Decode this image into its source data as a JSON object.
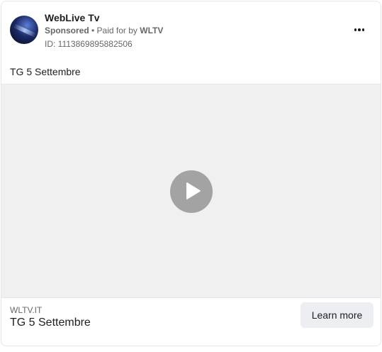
{
  "header": {
    "page_name": "WebLive Tv",
    "sponsored": "Sponsored",
    "separator": " • ",
    "paid_for_prefix": "Paid for by ",
    "paid_for_name": "WLTV",
    "ad_id": "ID: 1113869895882506",
    "more_icon": "more-horizontal-icon"
  },
  "post": {
    "text": "TG 5 Settembre"
  },
  "video": {
    "play_icon": "play-icon",
    "background_color": "#f0f0f0",
    "play_color": "#a3a3a3"
  },
  "footer": {
    "domain": "WLTV.IT",
    "headline": "TG 5 Settembre",
    "cta_label": "Learn more"
  }
}
